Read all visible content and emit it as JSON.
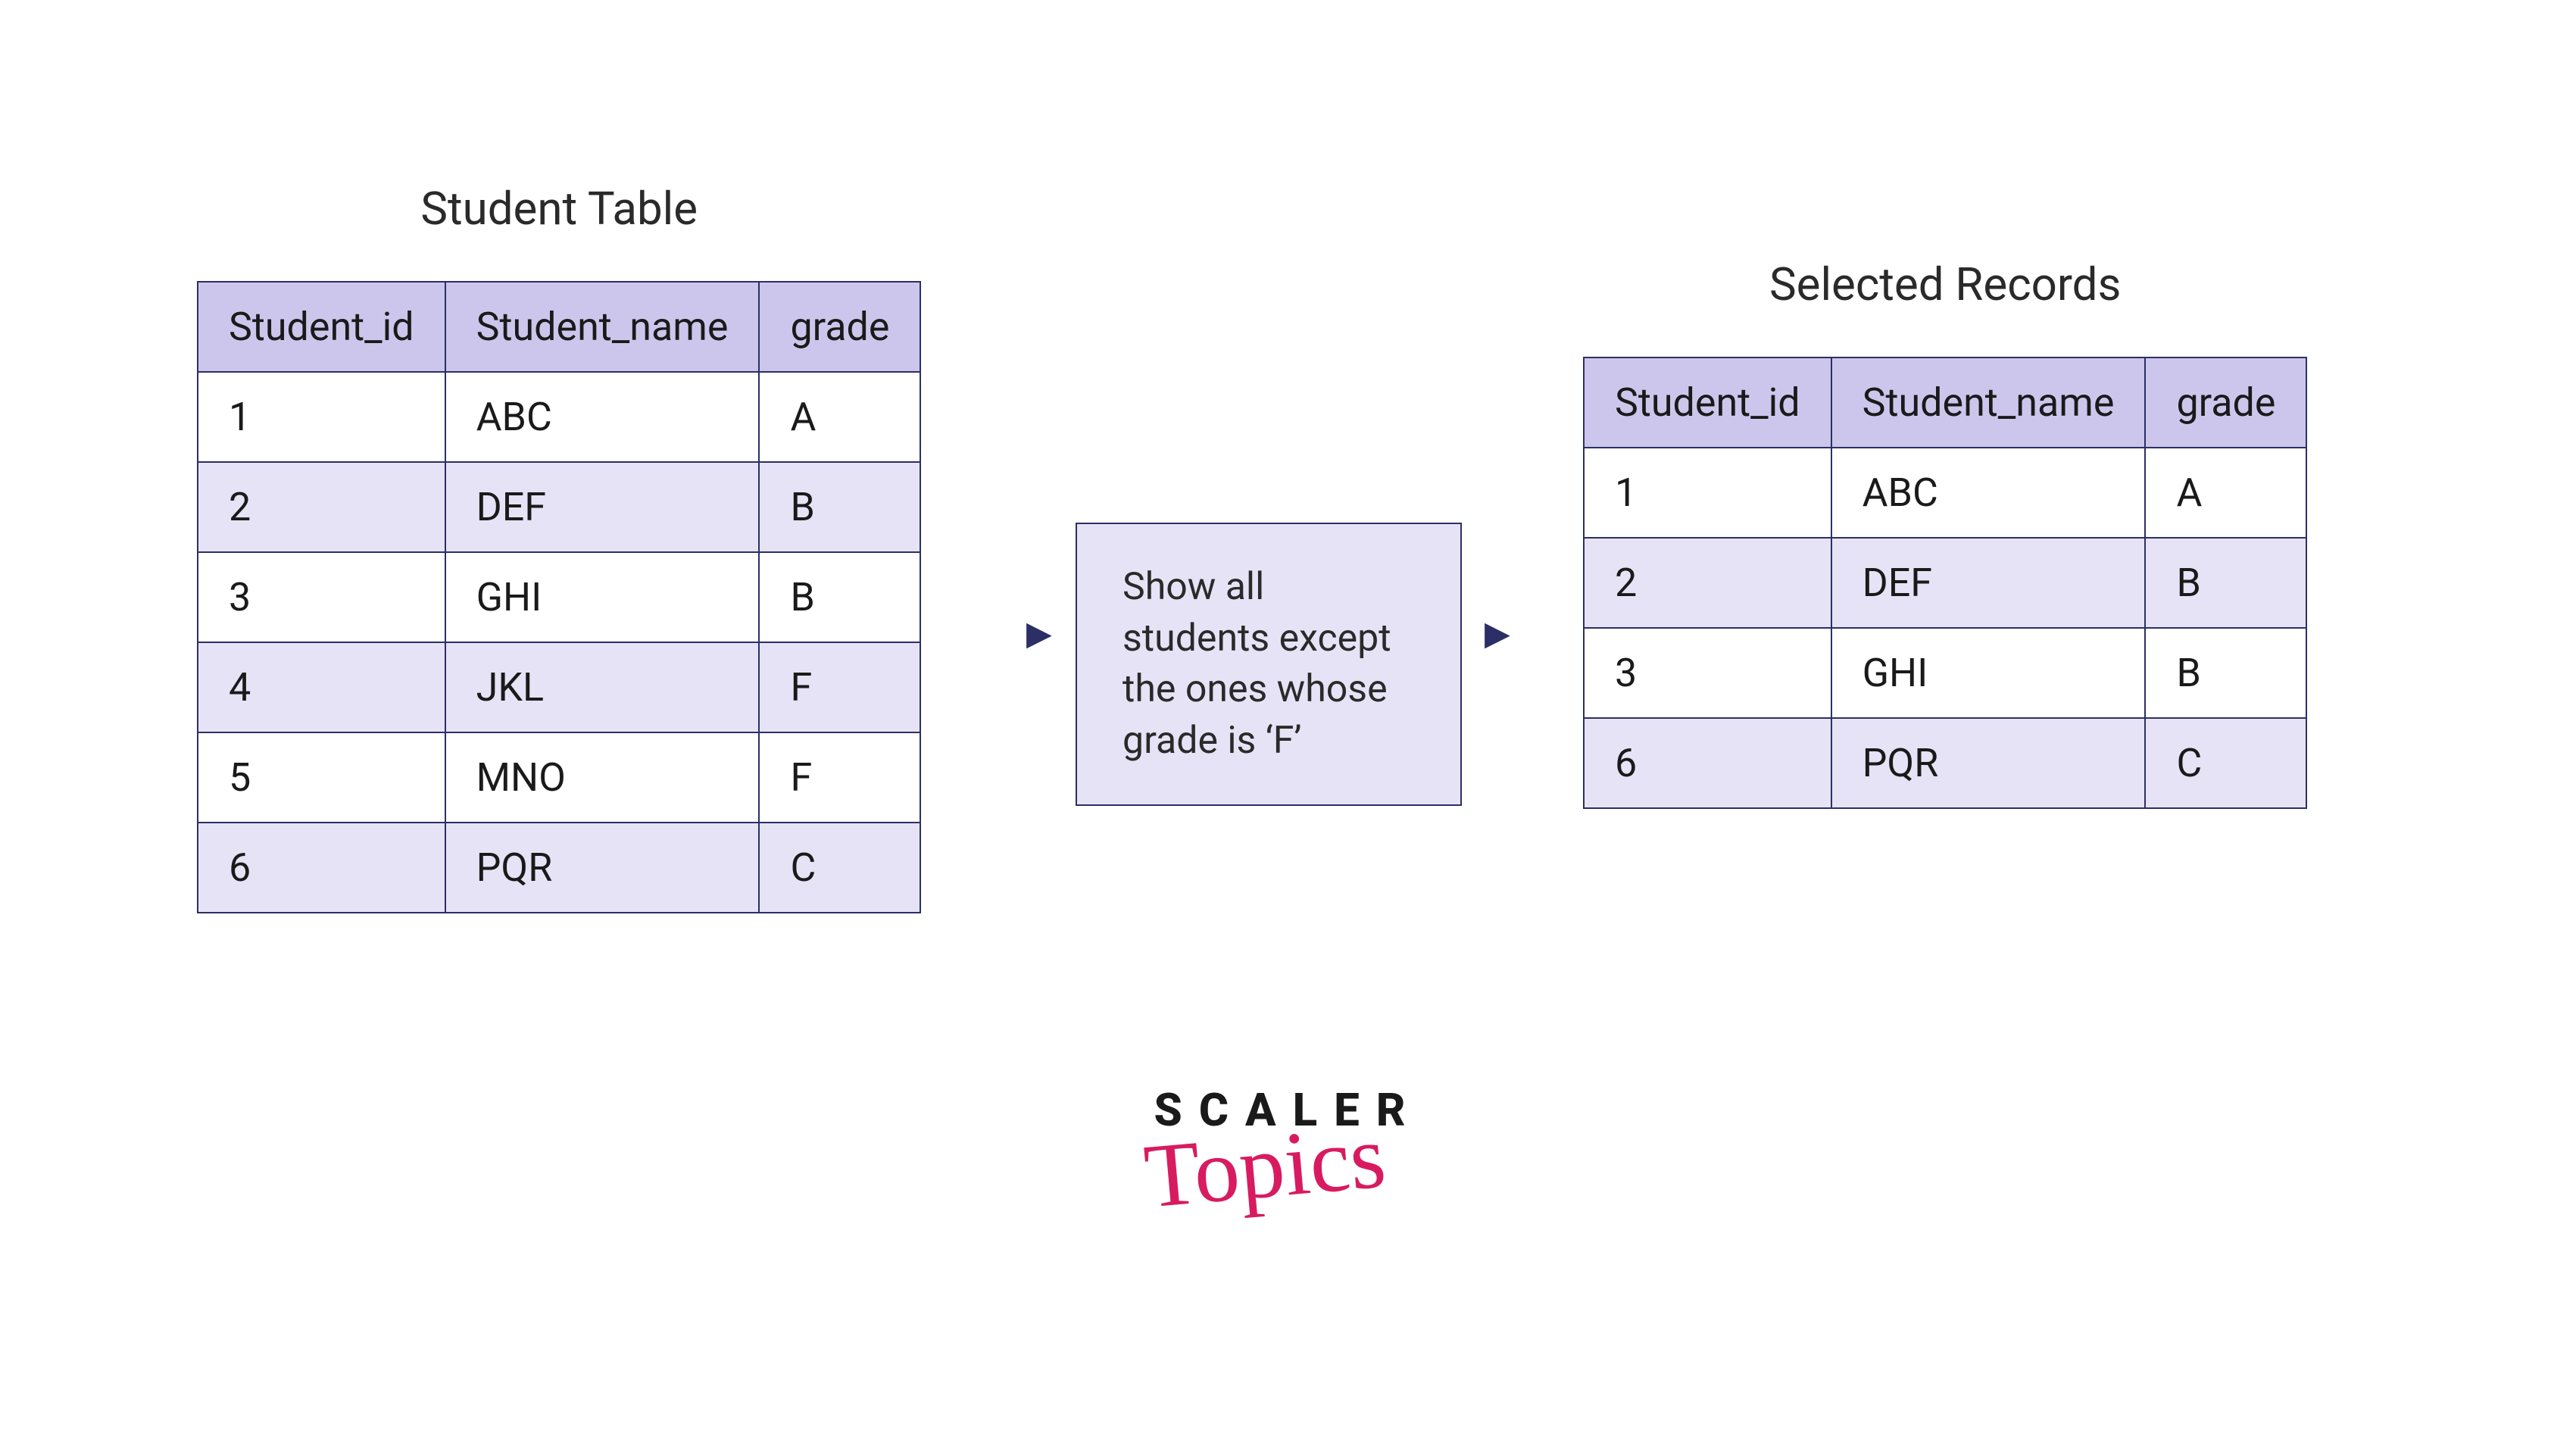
{
  "left_table": {
    "title": "Student Table",
    "headers": [
      "Student_id",
      "Student_name",
      "grade"
    ],
    "rows": [
      {
        "id": "1",
        "name": "ABC",
        "grade": "A"
      },
      {
        "id": "2",
        "name": "DEF",
        "grade": "B"
      },
      {
        "id": "3",
        "name": "GHI",
        "grade": "B"
      },
      {
        "id": "4",
        "name": "JKL",
        "grade": "F"
      },
      {
        "id": "5",
        "name": "MNO",
        "grade": "F"
      },
      {
        "id": "6",
        "name": "PQR",
        "grade": "C"
      }
    ]
  },
  "filter_text": "Show all students except the ones whose grade is ‘F’",
  "right_table": {
    "title": "Selected Records",
    "headers": [
      "Student_id",
      "Student_name",
      "grade"
    ],
    "rows": [
      {
        "id": "1",
        "name": "ABC",
        "grade": "A"
      },
      {
        "id": "2",
        "name": "DEF",
        "grade": "B"
      },
      {
        "id": "3",
        "name": "GHI",
        "grade": "B"
      },
      {
        "id": "6",
        "name": "PQR",
        "grade": "C"
      }
    ]
  },
  "logo": {
    "line1": "SCALER",
    "line2": "Topics"
  },
  "arrow_glyph": "▶"
}
